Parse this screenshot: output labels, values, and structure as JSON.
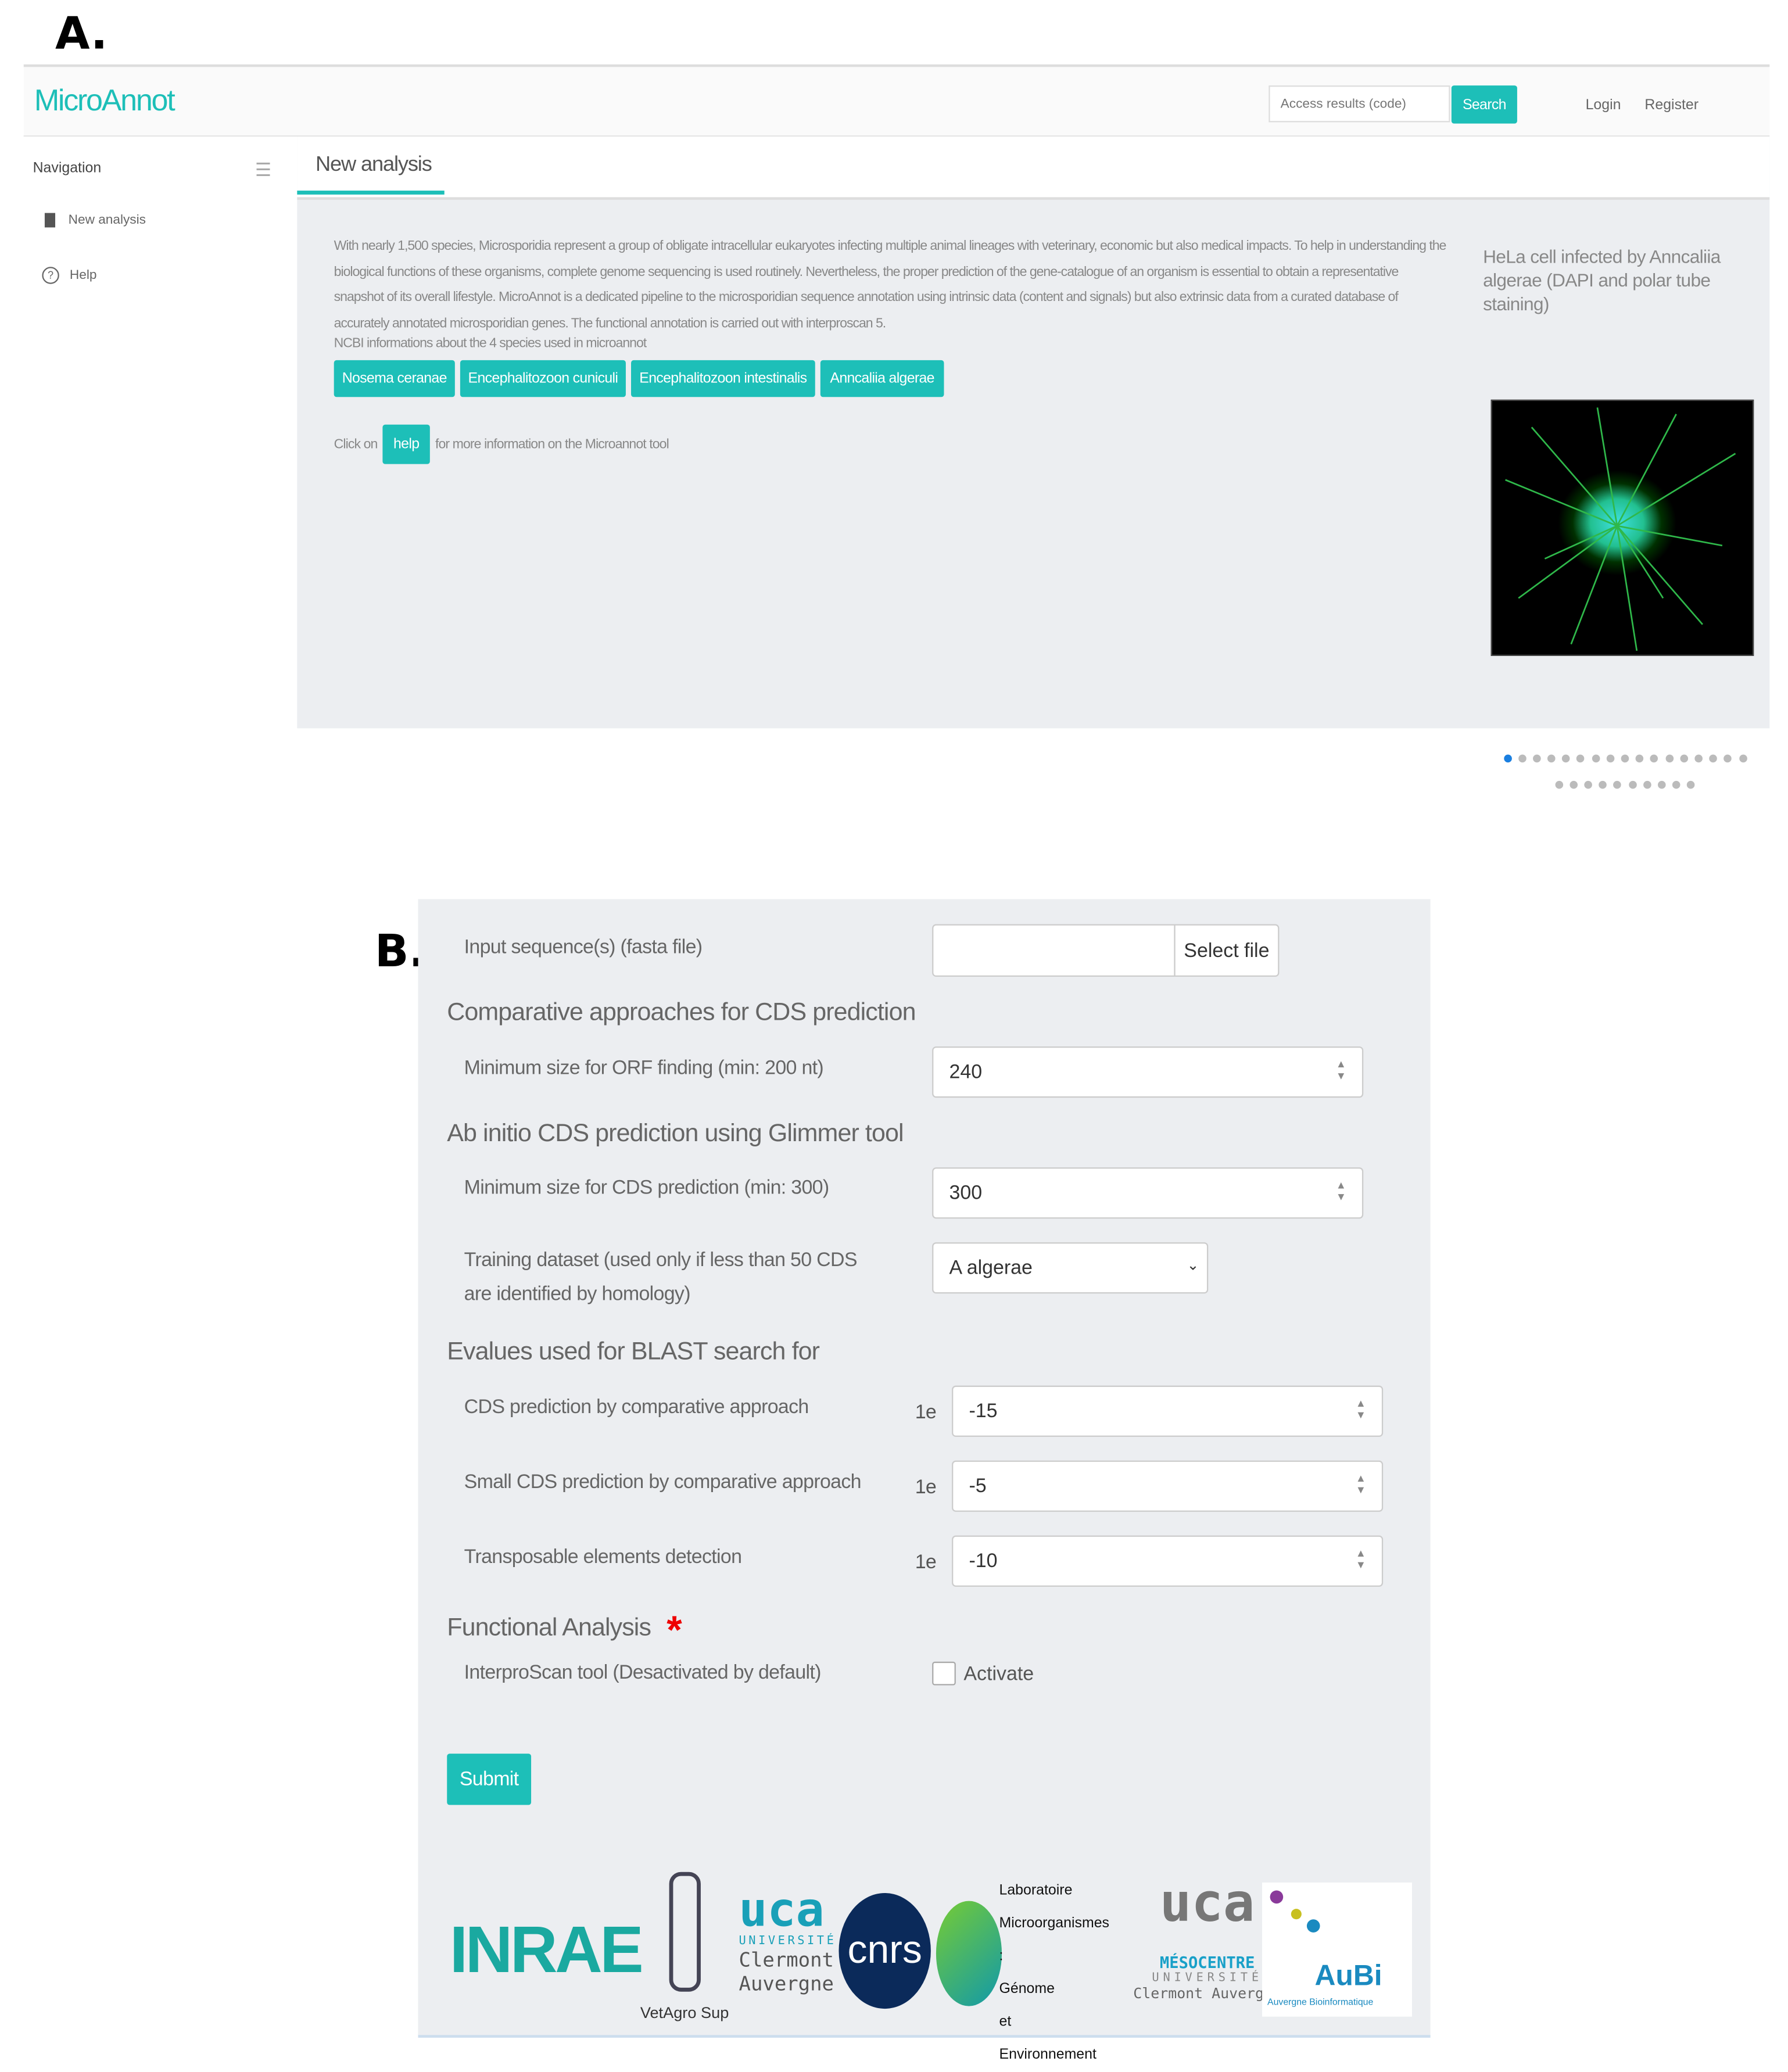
{
  "panel_a": {
    "label": "A.",
    "header": {
      "brand": "MicroAnnot",
      "search_placeholder": "Access results (code)",
      "search_button": "Search",
      "login": "Login",
      "register": "Register"
    },
    "sidebar": {
      "title": "Navigation",
      "items": [
        {
          "label": "New analysis",
          "icon": "file-icon"
        },
        {
          "label": "Help",
          "icon": "question-circle-icon"
        }
      ]
    },
    "tab": "New analysis",
    "intro": "With nearly 1,500 species, Microsporidia represent a group of obligate intracellular eukaryotes infecting multiple animal lineages with veterinary, economic but also medical impacts. To help in understanding the biological functions of these organisms, complete genome sequencing is used routinely. Nevertheless, the proper prediction of the gene-catalogue of an organism is essential to obtain a representative snapshot of its overall lifestyle. MicroAnnot is a dedicated pipeline to the microsporidian sequence annotation using intrinsic data (content and signals) but also extrinsic data from a curated database of accurately annotated microsporidian genes. The functional annotation is carried out with interproscan 5.",
    "ncbi_text": "NCBI informations about the 4 species used in microannot",
    "species": [
      "Nosema ceranae",
      "Encephalitozoon cuniculi",
      "Encephalitozoon intestinalis",
      "Anncaliia algerae"
    ],
    "help_prefix": "Click on",
    "help_button": "help",
    "help_suffix": "for more information on the Microannot tool",
    "carousel": {
      "caption": "HeLa cell infected by Anncaliia algerae (DAPI and polar tube staining)",
      "active_index": 0,
      "total": 27
    },
    "accent": "#1dbfb8"
  },
  "panel_b": {
    "label": "B.",
    "input_label": "Input sequence(s) (fasta file)",
    "select_file": "Select file",
    "sec1": "Comparative approaches for CDS prediction",
    "orf_label": "Minimum size for ORF finding (min: 200 nt)",
    "orf_value": "240",
    "sec2": "Ab initio CDS prediction using Glimmer tool",
    "cds_label": "Minimum size for CDS prediction (min: 300)",
    "cds_value": "300",
    "train_label": "Training dataset (used only if less than 50 CDS are identified by homology)",
    "train_value": "A algerae",
    "sec3": "Evalues used for BLAST search for",
    "evalues": [
      {
        "label": "CDS prediction by comparative approach",
        "prefix": "1e",
        "value": "-15"
      },
      {
        "label": "Small CDS prediction by comparative approach",
        "prefix": "1e",
        "value": "-5"
      },
      {
        "label": "Transposable elements detection",
        "prefix": "1e",
        "value": "-10"
      }
    ],
    "sec4": "Functional Analysis",
    "required_mark": "*",
    "interpro_label": "InterproScan tool (Desactivated by default)",
    "activate": "Activate",
    "activate_checked": false,
    "submit": "Submit",
    "logos": [
      "INRAE",
      "VetAgro Sup",
      "UCA Université Clermont Auvergne",
      "CNRS",
      "Laboratoire Microorganismes : Génome et Environnement",
      "UCA Mésocentre Université Clermont Auvergne",
      "AuBi Auvergne Bioinformatique"
    ]
  }
}
